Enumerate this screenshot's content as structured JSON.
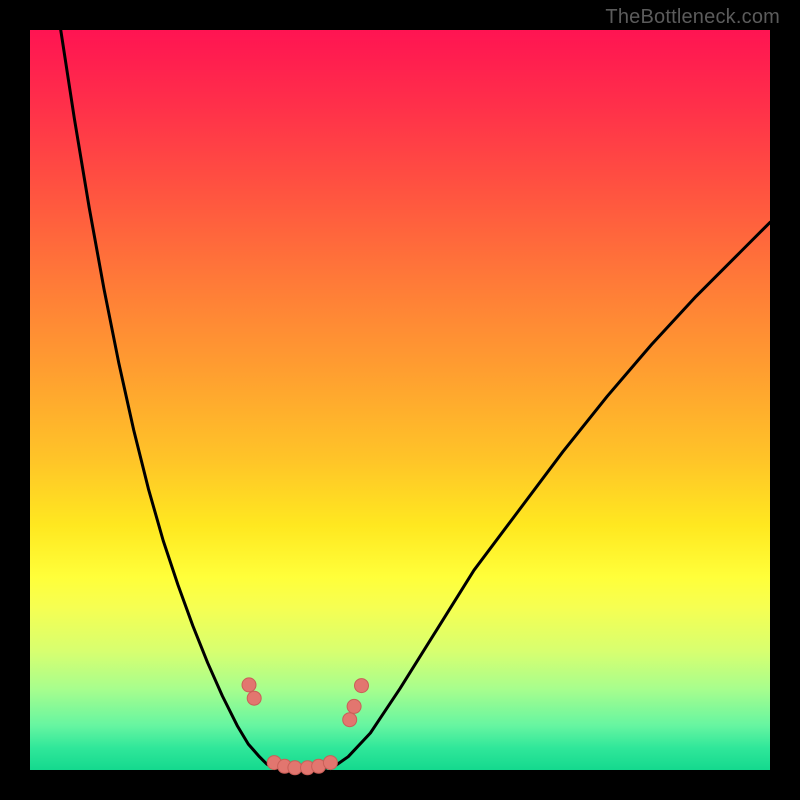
{
  "watermark": "TheBottleneck.com",
  "colors": {
    "frame": "#000000",
    "curve_stroke": "#000000",
    "marker_fill": "#e2766f",
    "marker_stroke": "#c95f58"
  },
  "chart_data": {
    "type": "line",
    "title": "",
    "xlabel": "",
    "ylabel": "",
    "xlim": [
      0,
      100
    ],
    "ylim": [
      0,
      100
    ],
    "grid": false,
    "annotations": [
      "TheBottleneck.com"
    ],
    "series": [
      {
        "name": "left-branch",
        "x": [
          4,
          6,
          8,
          10,
          12,
          14,
          16,
          18,
          20,
          22,
          24,
          26,
          28,
          29.5,
          31,
          32,
          33
        ],
        "y": [
          101,
          88,
          76,
          65,
          55,
          46,
          38,
          31,
          25,
          19.5,
          14.5,
          10,
          6,
          3.5,
          1.8,
          0.8,
          0.2
        ]
      },
      {
        "name": "trough",
        "x": [
          33,
          35,
          37,
          39,
          41
        ],
        "y": [
          0.2,
          0.0,
          0.0,
          0.1,
          0.4
        ]
      },
      {
        "name": "right-branch",
        "x": [
          41,
          43,
          46,
          50,
          55,
          60,
          66,
          72,
          78,
          84,
          90,
          96,
          100
        ],
        "y": [
          0.4,
          1.8,
          5,
          11,
          19,
          27,
          35,
          43,
          50.5,
          57.5,
          64,
          70,
          74
        ]
      }
    ],
    "markers": [
      {
        "x": 29.6,
        "y": 11.5
      },
      {
        "x": 30.3,
        "y": 9.7
      },
      {
        "x": 33.0,
        "y": 1.0
      },
      {
        "x": 34.4,
        "y": 0.5
      },
      {
        "x": 35.8,
        "y": 0.3
      },
      {
        "x": 37.5,
        "y": 0.3
      },
      {
        "x": 39.0,
        "y": 0.5
      },
      {
        "x": 40.6,
        "y": 1.0
      },
      {
        "x": 43.2,
        "y": 6.8
      },
      {
        "x": 43.8,
        "y": 8.6
      },
      {
        "x": 44.8,
        "y": 11.4
      }
    ],
    "marker_radius_pct": 0.95
  }
}
